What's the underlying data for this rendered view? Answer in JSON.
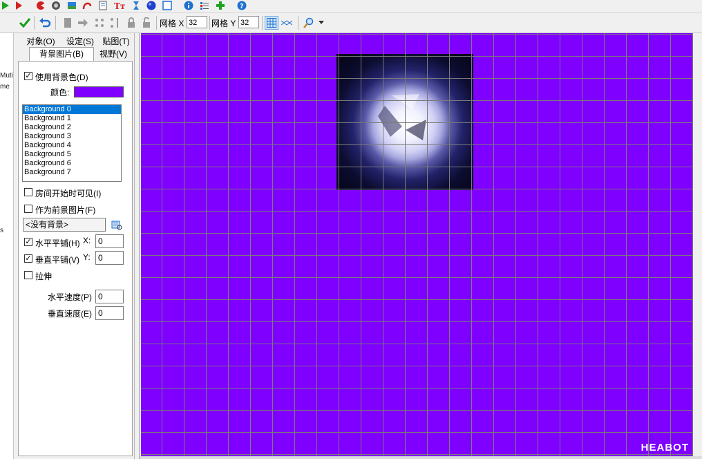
{
  "colors": {
    "room_background": "#7f00ff",
    "selection": "#0078d7"
  },
  "top_icons": [
    "run-icon",
    "debug-icon",
    "sprite-icon",
    "sound-icon",
    "background-icon",
    "path-icon",
    "script-icon",
    "font-icon",
    "timeline-icon",
    "object-icon",
    "room-icon",
    "game-info-icon",
    "global-settings-icon",
    "extension-icon",
    "help-icon"
  ],
  "toolbar": {
    "grid_x_label": "网格 X",
    "grid_x_value": "32",
    "grid_y_label": "网格 Y",
    "grid_y_value": "32"
  },
  "left_strip": {
    "text1": "Muti",
    "text2": "me",
    "text3": "s"
  },
  "tabs": {
    "objects": "对象(O)",
    "settings": "设定(S)",
    "tiles": "贴图(T)",
    "backgrounds": "背景图片(B)",
    "views": "视野(V)"
  },
  "panel": {
    "use_bg_color_label": "使用背景色(D)",
    "use_bg_color_checked": true,
    "color_label": "颜色:",
    "backgrounds": [
      "Background 0",
      "Background 1",
      "Background 2",
      "Background 3",
      "Background 4",
      "Background 5",
      "Background 6",
      "Background 7"
    ],
    "selected_background": "Background 0",
    "visible_at_start_label": "房间开始时可见(I)",
    "visible_at_start_checked": false,
    "foreground_label": "作为前景图片(F)",
    "foreground_checked": false,
    "background_select_value": "<没有背景>",
    "tile_h_label": "水平平铺(H)",
    "tile_h_checked": true,
    "x_label": "X:",
    "x_value": "0",
    "tile_v_label": "垂直平铺(V)",
    "tile_v_checked": true,
    "y_label": "Y:",
    "y_value": "0",
    "stretch_label": "拉伸",
    "stretch_checked": false,
    "hspeed_label": "水平速度(P)",
    "hspeed_value": "0",
    "vspeed_label": "垂直速度(E)",
    "vspeed_value": "0"
  },
  "watermark": "HEABOT"
}
